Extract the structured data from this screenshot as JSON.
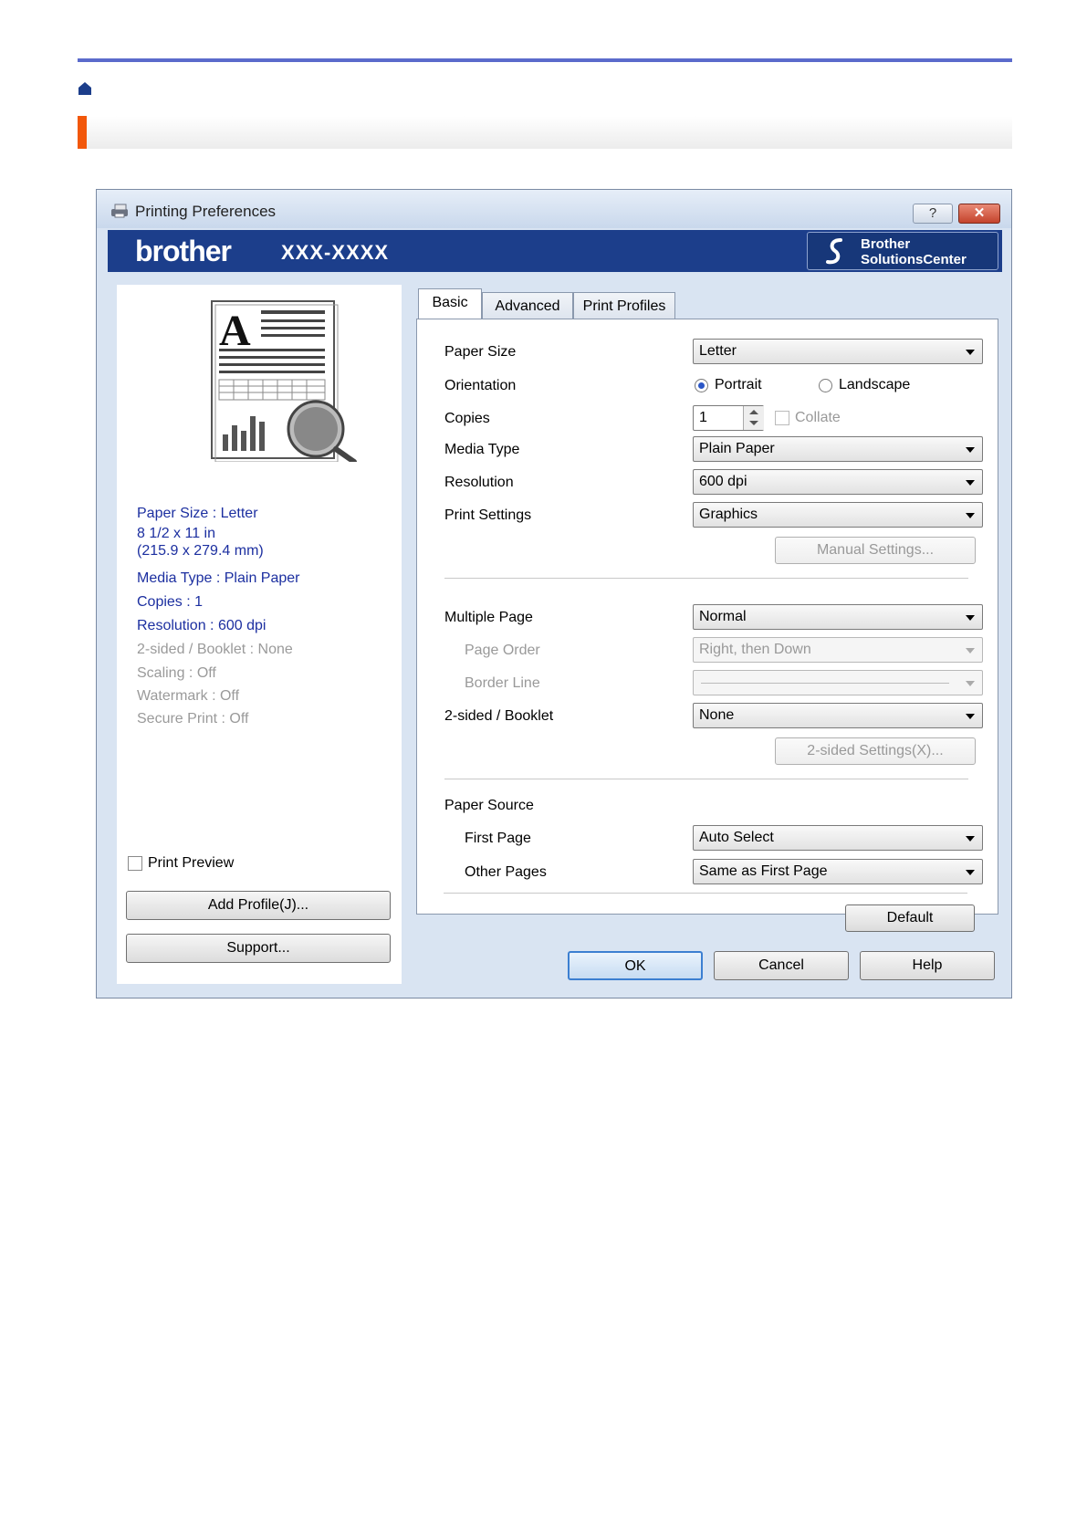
{
  "window": {
    "title": "Printing Preferences",
    "help_glyph": "?",
    "close_glyph": "✕"
  },
  "banner": {
    "brand": "brother",
    "model": "XXX-XXXX",
    "solutions_line1": "Brother",
    "solutions_line2": "SolutionsCenter"
  },
  "summary": {
    "paper_size": "Paper Size : Letter",
    "paper_dims1": "8 1/2 x 11 in",
    "paper_dims2": "(215.9 x 279.4 mm)",
    "media_type": "Media Type : Plain Paper",
    "copies": "Copies : 1",
    "resolution": "Resolution : 600 dpi",
    "two_sided": "2-sided / Booklet : None",
    "scaling": "Scaling : Off",
    "watermark": "Watermark : Off",
    "secure_print": "Secure Print : Off"
  },
  "left_controls": {
    "print_preview": "Print Preview",
    "add_profile": "Add Profile(J)...",
    "support": "Support..."
  },
  "tabs": [
    "Basic",
    "Advanced",
    "Print Profiles"
  ],
  "basic": {
    "paper_size_label": "Paper Size",
    "paper_size_value": "Letter",
    "orientation_label": "Orientation",
    "portrait": "Portrait",
    "landscape": "Landscape",
    "copies_label": "Copies",
    "copies_value": "1",
    "collate": "Collate",
    "media_type_label": "Media Type",
    "media_type_value": "Plain Paper",
    "resolution_label": "Resolution",
    "resolution_value": "600 dpi",
    "print_settings_label": "Print Settings",
    "print_settings_value": "Graphics",
    "manual_settings": "Manual Settings...",
    "multiple_page_label": "Multiple Page",
    "multiple_page_value": "Normal",
    "page_order_label": "Page Order",
    "page_order_value": "Right, then Down",
    "border_line_label": "Border Line",
    "two_sided_label": "2-sided / Booklet",
    "two_sided_value": "None",
    "two_sided_settings": "2-sided Settings(X)...",
    "paper_source_label": "Paper Source",
    "first_page_label": "First Page",
    "first_page_value": "Auto Select",
    "other_pages_label": "Other Pages",
    "other_pages_value": "Same as First Page",
    "default_btn": "Default"
  },
  "footer": {
    "ok": "OK",
    "cancel": "Cancel",
    "help": "Help"
  },
  "colors": {
    "accent_orange": "#f2570a",
    "banner_blue": "#1c3e8b",
    "summary_blue": "#1c2fa0"
  }
}
